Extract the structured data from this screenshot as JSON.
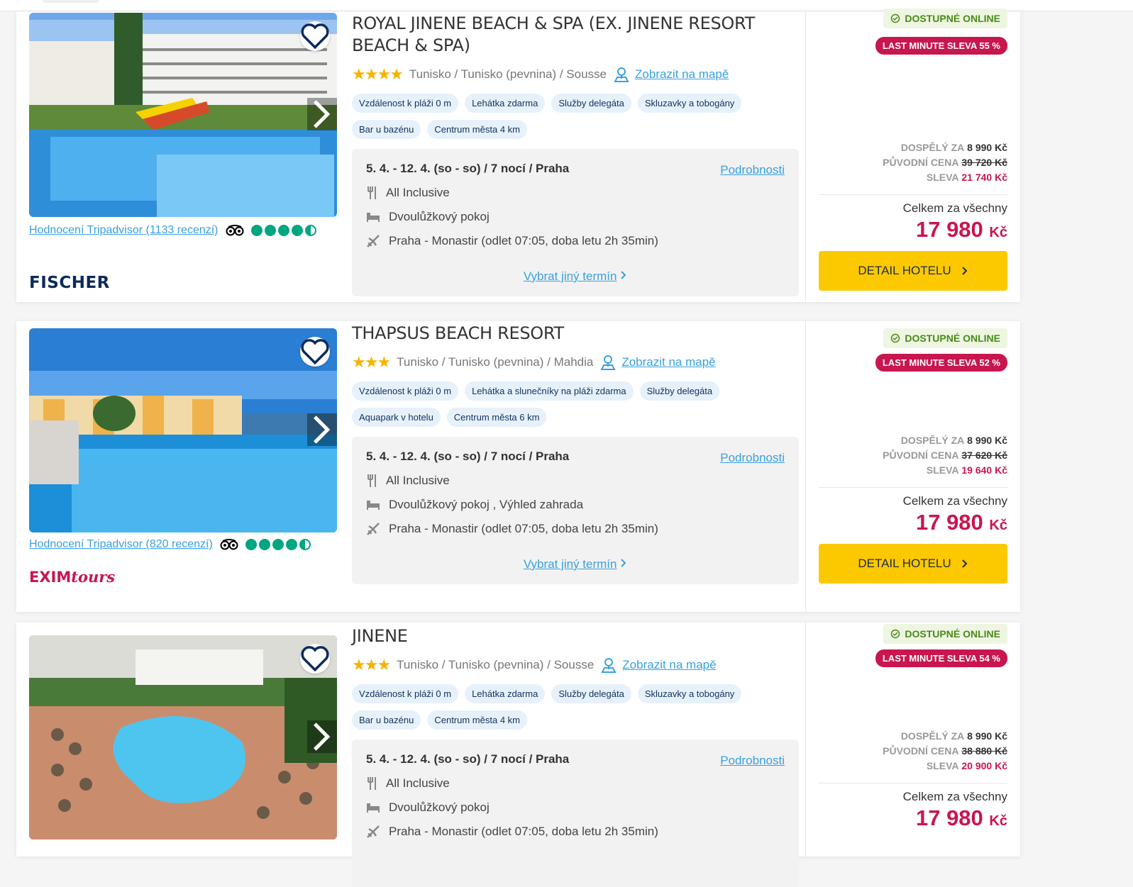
{
  "labels": {
    "online": "DOSTUPNÉ ONLINE",
    "adult": "DOSPĚLÝ ZA",
    "original": "PŮVODNÍ CENA",
    "discount": "SLEVA",
    "total_label": "Celkem za všechny",
    "currency": "Kč",
    "details": "Podrobnosti",
    "other_term": "Vybrat jiný termín",
    "map": "Zobrazit na mapě",
    "detail_button": "DETAIL HOTELU"
  },
  "hotels": [
    {
      "title": "ROYAL JINENE BEACH & SPA (EX. JINENE RESORT BEACH & SPA)",
      "stars": "★★★★",
      "location": "Tunisko / Tunisko (pevnina) / Sousse",
      "tags": [
        "Vzdálenost k pláži 0 m",
        "Lehátka zdarma",
        "Služby delegáta",
        "Skluzavky a tobogány",
        "Bar u bazénu",
        "Centrum města 4 km"
      ],
      "term": "5. 4. - 12. 4. (so - so) / 7 nocí / Praha",
      "board": "All Inclusive",
      "room": "Dvoulůžkový pokoj",
      "flight": "Praha - Monastir (odlet 07:05, doba letu 2h 35min)",
      "tripadvisor": "Hodnocení Tripadvisor (1133 recenzí)",
      "rating": 4.5,
      "brand": "FISCHER",
      "last_minute": "LAST MINUTE SLEVA 55 %",
      "adult_price": "8 990 Kč",
      "original_price": "39 720 Kč",
      "discount": "21 740 Kč",
      "total": "17 980"
    },
    {
      "title": "THAPSUS BEACH RESORT",
      "stars": "★★★",
      "location": "Tunisko / Tunisko (pevnina) / Mahdia",
      "tags": [
        "Vzdálenost k pláži 0 m",
        "Lehátka a slunečníky na pláži zdarma",
        "Služby delegáta",
        "Aquapark v hotelu",
        "Centrum města 6 km"
      ],
      "term": "5. 4. - 12. 4. (so - so) / 7 nocí / Praha",
      "board": "All Inclusive",
      "room": "Dvoulůžkový pokoj , Výhled zahrada",
      "flight": "Praha - Monastir (odlet 07:05, doba letu 2h 35min)",
      "tripadvisor": "Hodnocení Tripadvisor (820 recenzí)",
      "rating": 4.5,
      "brand": "EXIM",
      "brand2": "tours",
      "last_minute": "LAST MINUTE SLEVA 52 %",
      "adult_price": "8 990 Kč",
      "original_price": "37 620 Kč",
      "discount": "19 640 Kč",
      "total": "17 980"
    },
    {
      "title": "JINENE",
      "stars": "★★★",
      "location": "Tunisko / Tunisko (pevnina) / Sousse",
      "tags": [
        "Vzdálenost k pláži 0 m",
        "Lehátka zdarma",
        "Služby delegáta",
        "Skluzavky a tobogány",
        "Bar u bazénu",
        "Centrum města 4 km"
      ],
      "term": "5. 4. - 12. 4. (so - so) / 7 nocí / Praha",
      "board": "All Inclusive",
      "room": "Dvoulůžkový pokoj",
      "flight": "Praha - Monastir (odlet 07:05, doba letu 2h 35min)",
      "last_minute": "LAST MINUTE SLEVA 54 %",
      "adult_price": "8 990 Kč",
      "original_price": "38 880 Kč",
      "discount": "20 900 Kč",
      "total": "17 980"
    }
  ],
  "colors": {
    "accent": "#c8164f",
    "link": "#3aa0e0",
    "button": "#fcc900",
    "online_green": "#4a8a1a"
  }
}
